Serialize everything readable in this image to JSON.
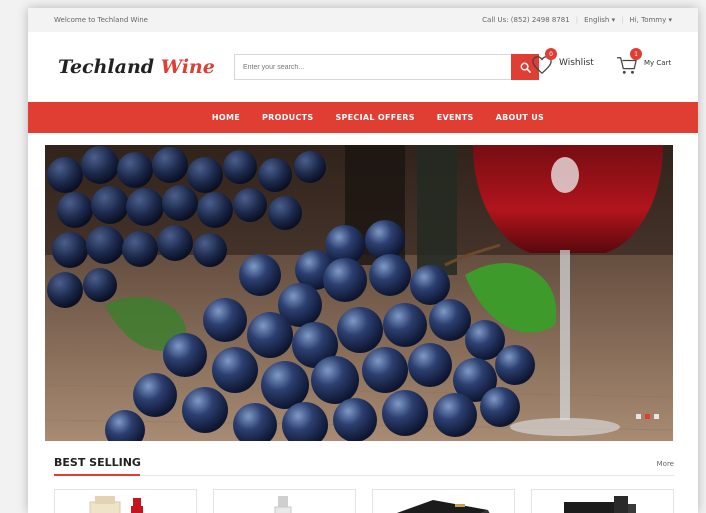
{
  "topbar": {
    "welcome": "Welcome to Techland Wine",
    "call": "Call Us: (852) 2498 8781",
    "language": "English ▾",
    "user": "Hi, Tommy ▾"
  },
  "header": {
    "logo_main": "Techland",
    "logo_accent": "Wine",
    "search_placeholder": "Enter your search...",
    "wishlist_label": "Wishlist",
    "wishlist_count": "0",
    "cart_label": "My Cart",
    "cart_count": "1"
  },
  "nav": {
    "items": [
      {
        "label": "HOME"
      },
      {
        "label": "PRODUCTS"
      },
      {
        "label": "SPECIAL OFFERS"
      },
      {
        "label": "EVENTS"
      },
      {
        "label": "ABOUT US"
      }
    ]
  },
  "hero": {
    "slide_count": 3,
    "active_slide": 2
  },
  "best_selling": {
    "title": "BEST SELLING",
    "more": "More"
  },
  "colors": {
    "accent": "#e03d33",
    "topbar_bg": "#f3f3f3"
  },
  "icons": [
    "search-icon",
    "heart-icon",
    "cart-icon"
  ]
}
